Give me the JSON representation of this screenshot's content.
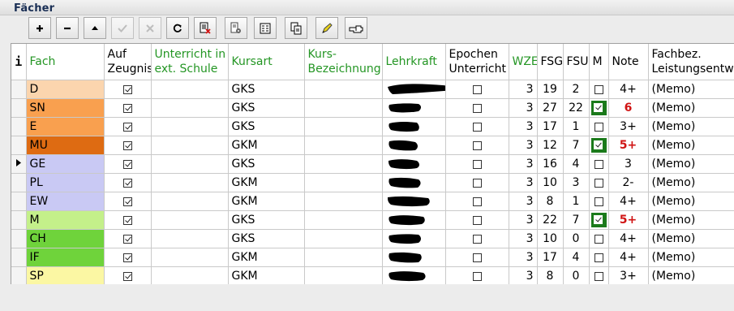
{
  "window": {
    "title": "Fächer"
  },
  "toolbar": {
    "buttons": [
      {
        "name": "add-button",
        "icon": "plus-icon",
        "enabled": true
      },
      {
        "name": "remove-button",
        "icon": "minus-icon",
        "enabled": true
      },
      {
        "name": "move-up-button",
        "icon": "arrow-up-icon",
        "enabled": true
      },
      {
        "name": "confirm-button",
        "icon": "check-icon",
        "enabled": false
      },
      {
        "name": "cancel-button",
        "icon": "cross-icon",
        "enabled": false
      },
      {
        "name": "refresh-button",
        "icon": "refresh-icon",
        "enabled": true
      },
      {
        "name": "document-edit-button",
        "icon": "document-red-icon",
        "enabled": true
      },
      {
        "name": "document-settings-button",
        "icon": "document-gear-icon",
        "enabled": true
      },
      {
        "name": "report-button",
        "icon": "report-icon",
        "enabled": true
      },
      {
        "name": "copy-button",
        "icon": "copy-icon",
        "enabled": true
      },
      {
        "name": "pen-button",
        "icon": "pen-icon",
        "enabled": true
      },
      {
        "name": "pointer-button",
        "icon": "hand-pointer-icon",
        "enabled": true
      }
    ]
  },
  "grid": {
    "info_label": "i",
    "columns": {
      "fach": "Fach",
      "auf_zeugnis": "Auf Zeugnis",
      "unterricht": "Unterricht in ext. Schule",
      "kursart": "Kursart",
      "kurs_bez": "Kurs-Bezeichnung",
      "lehrkraft": "Lehrkraft",
      "epochen": "Epochen Unterricht",
      "wze": "WZE",
      "fsg": "FSG",
      "fsu": "FSU",
      "m": "M",
      "note": "Note",
      "fachbez": "Fachbez. Leistungsentw"
    },
    "rows": [
      {
        "fach": "D",
        "color": "#fbd5ae",
        "zeugnis": true,
        "kursart": "GKS",
        "epochen": false,
        "wze": "3",
        "fsg": "19",
        "fsu": "2",
        "m": false,
        "note": "4+",
        "note_red": false,
        "memo": "(Memo)",
        "current": false
      },
      {
        "fach": "SN",
        "color": "#f9a04f",
        "zeugnis": true,
        "kursart": "GKS",
        "epochen": false,
        "wze": "3",
        "fsg": "27",
        "fsu": "22",
        "m": true,
        "note": "6",
        "note_red": true,
        "memo": "(Memo)",
        "current": false
      },
      {
        "fach": "E",
        "color": "#f9a04f",
        "zeugnis": true,
        "kursart": "GKS",
        "epochen": false,
        "wze": "3",
        "fsg": "17",
        "fsu": "1",
        "m": false,
        "note": "3+",
        "note_red": false,
        "memo": "(Memo)",
        "current": false
      },
      {
        "fach": "MU",
        "color": "#de6b12",
        "zeugnis": true,
        "kursart": "GKM",
        "epochen": false,
        "wze": "3",
        "fsg": "12",
        "fsu": "7",
        "m": true,
        "note": "5+",
        "note_red": true,
        "memo": "(Memo)",
        "current": false
      },
      {
        "fach": "GE",
        "color": "#c9c9f4",
        "zeugnis": true,
        "kursart": "GKS",
        "epochen": false,
        "wze": "3",
        "fsg": "16",
        "fsu": "4",
        "m": false,
        "note": "3",
        "note_red": false,
        "memo": "(Memo)",
        "current": true
      },
      {
        "fach": "PL",
        "color": "#c9c9f4",
        "zeugnis": true,
        "kursart": "GKM",
        "epochen": false,
        "wze": "3",
        "fsg": "10",
        "fsu": "3",
        "m": false,
        "note": "2-",
        "note_red": false,
        "memo": "(Memo)",
        "current": false
      },
      {
        "fach": "EW",
        "color": "#c9c9f4",
        "zeugnis": true,
        "kursart": "GKM",
        "epochen": false,
        "wze": "3",
        "fsg": "8",
        "fsu": "1",
        "m": false,
        "note": "4+",
        "note_red": false,
        "memo": "(Memo)",
        "current": false
      },
      {
        "fach": "M",
        "color": "#c4f08a",
        "zeugnis": true,
        "kursart": "GKS",
        "epochen": false,
        "wze": "3",
        "fsg": "22",
        "fsu": "7",
        "m": true,
        "note": "5+",
        "note_red": true,
        "memo": "(Memo)",
        "current": false
      },
      {
        "fach": "CH",
        "color": "#6fd33b",
        "zeugnis": true,
        "kursart": "GKS",
        "epochen": false,
        "wze": "3",
        "fsg": "10",
        "fsu": "0",
        "m": false,
        "note": "4+",
        "note_red": false,
        "memo": "(Memo)",
        "current": false
      },
      {
        "fach": "IF",
        "color": "#6fd33b",
        "zeugnis": true,
        "kursart": "GKM",
        "epochen": false,
        "wze": "3",
        "fsg": "17",
        "fsu": "4",
        "m": false,
        "note": "4+",
        "note_red": false,
        "memo": "(Memo)",
        "current": false
      },
      {
        "fach": "SP",
        "color": "#fbf7a3",
        "zeugnis": true,
        "kursart": "GKM",
        "epochen": false,
        "wze": "3",
        "fsg": "8",
        "fsu": "0",
        "m": false,
        "note": "3+",
        "note_red": false,
        "memo": "(Memo)",
        "current": false
      }
    ]
  }
}
